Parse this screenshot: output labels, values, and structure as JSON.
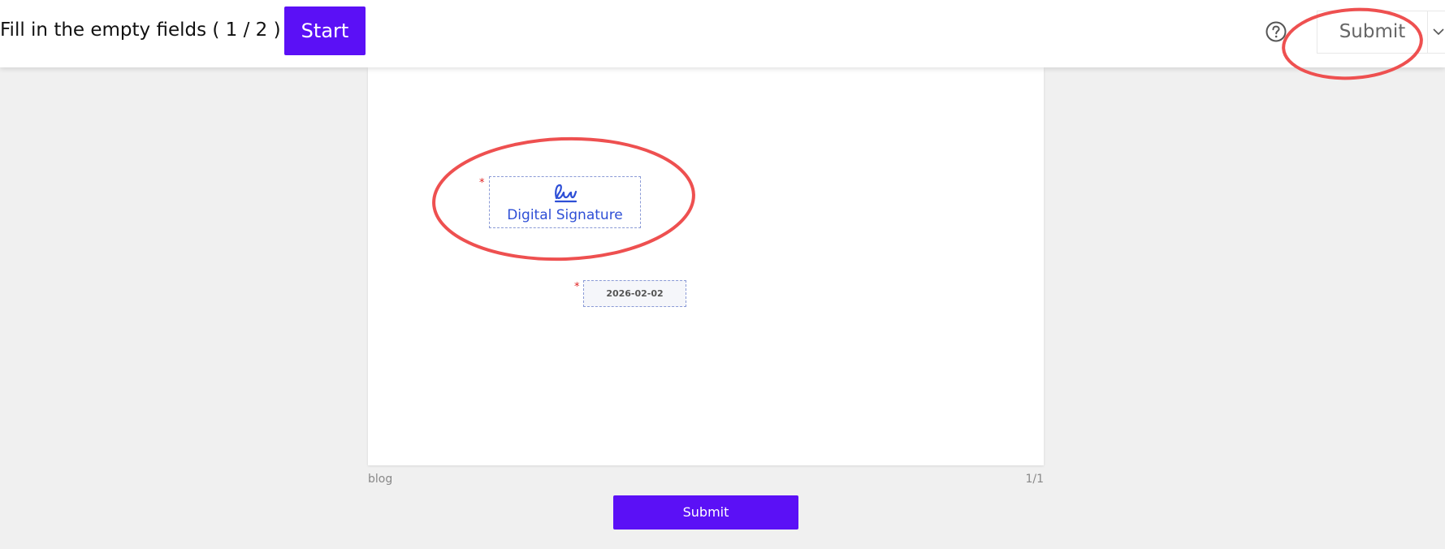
{
  "toolbar": {
    "title": "Fill in the empty fields ( 1 / 2 )",
    "start_label": "Start",
    "submit_label": "Submit"
  },
  "icons": {
    "help": "question-circle-icon",
    "dropdown": "chevron-down-icon",
    "signature": "signature-icon"
  },
  "document": {
    "signature_field_label": "Digital Signature",
    "date_value": "2026-02-02",
    "required_marker": "*",
    "file_name": "blog",
    "page_indicator": "1/1"
  },
  "footer": {
    "submit_label": "Submit"
  },
  "colors": {
    "accent": "#5b10f6",
    "signature_text": "#2e4fd6",
    "required": "#e02020",
    "annotation": "#ee5050"
  }
}
